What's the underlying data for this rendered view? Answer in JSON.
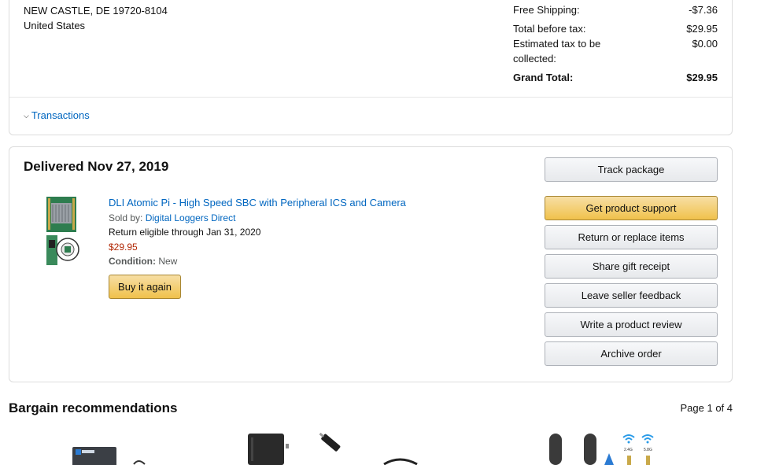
{
  "address": {
    "line1": "NEW CASTLE, DE 19720-8104",
    "line2": "United States"
  },
  "summary": {
    "free_shipping_label": "Free Shipping:",
    "free_shipping_value": "-$7.36",
    "total_before_tax_label": "Total before tax:",
    "total_before_tax_value": "$29.95",
    "estimated_tax_label": "Estimated tax to be collected:",
    "estimated_tax_value": "$0.00",
    "grand_total_label": "Grand Total:",
    "grand_total_value": "$29.95"
  },
  "transactions_label": "Transactions",
  "order": {
    "delivered_label": "Delivered Nov 27, 2019",
    "item": {
      "title": "DLI Atomic Pi - High Speed SBC with Peripheral ICS and Camera",
      "sold_by_label": "Sold by:",
      "seller": "Digital Loggers Direct",
      "return_text": "Return eligible through Jan 31, 2020",
      "price": "$29.95",
      "condition_label": "Condition:",
      "condition_value": "New",
      "buy_again_label": "Buy it again"
    },
    "actions": {
      "track": "Track package",
      "support": "Get product support",
      "return": "Return or replace items",
      "gift": "Share gift receipt",
      "seller_feedback": "Leave seller feedback",
      "review": "Write a product review",
      "archive": "Archive order"
    }
  },
  "recommendations": {
    "title": "Bargain recommendations",
    "page_indicator": "Page 1 of 4",
    "wifi_labels": [
      "2.4G",
      "5.8G"
    ]
  },
  "colors": {
    "link": "#0066c0",
    "price": "#b12704",
    "primary_button": "#f0c14b",
    "secondary_button": "#e7e9ec"
  }
}
